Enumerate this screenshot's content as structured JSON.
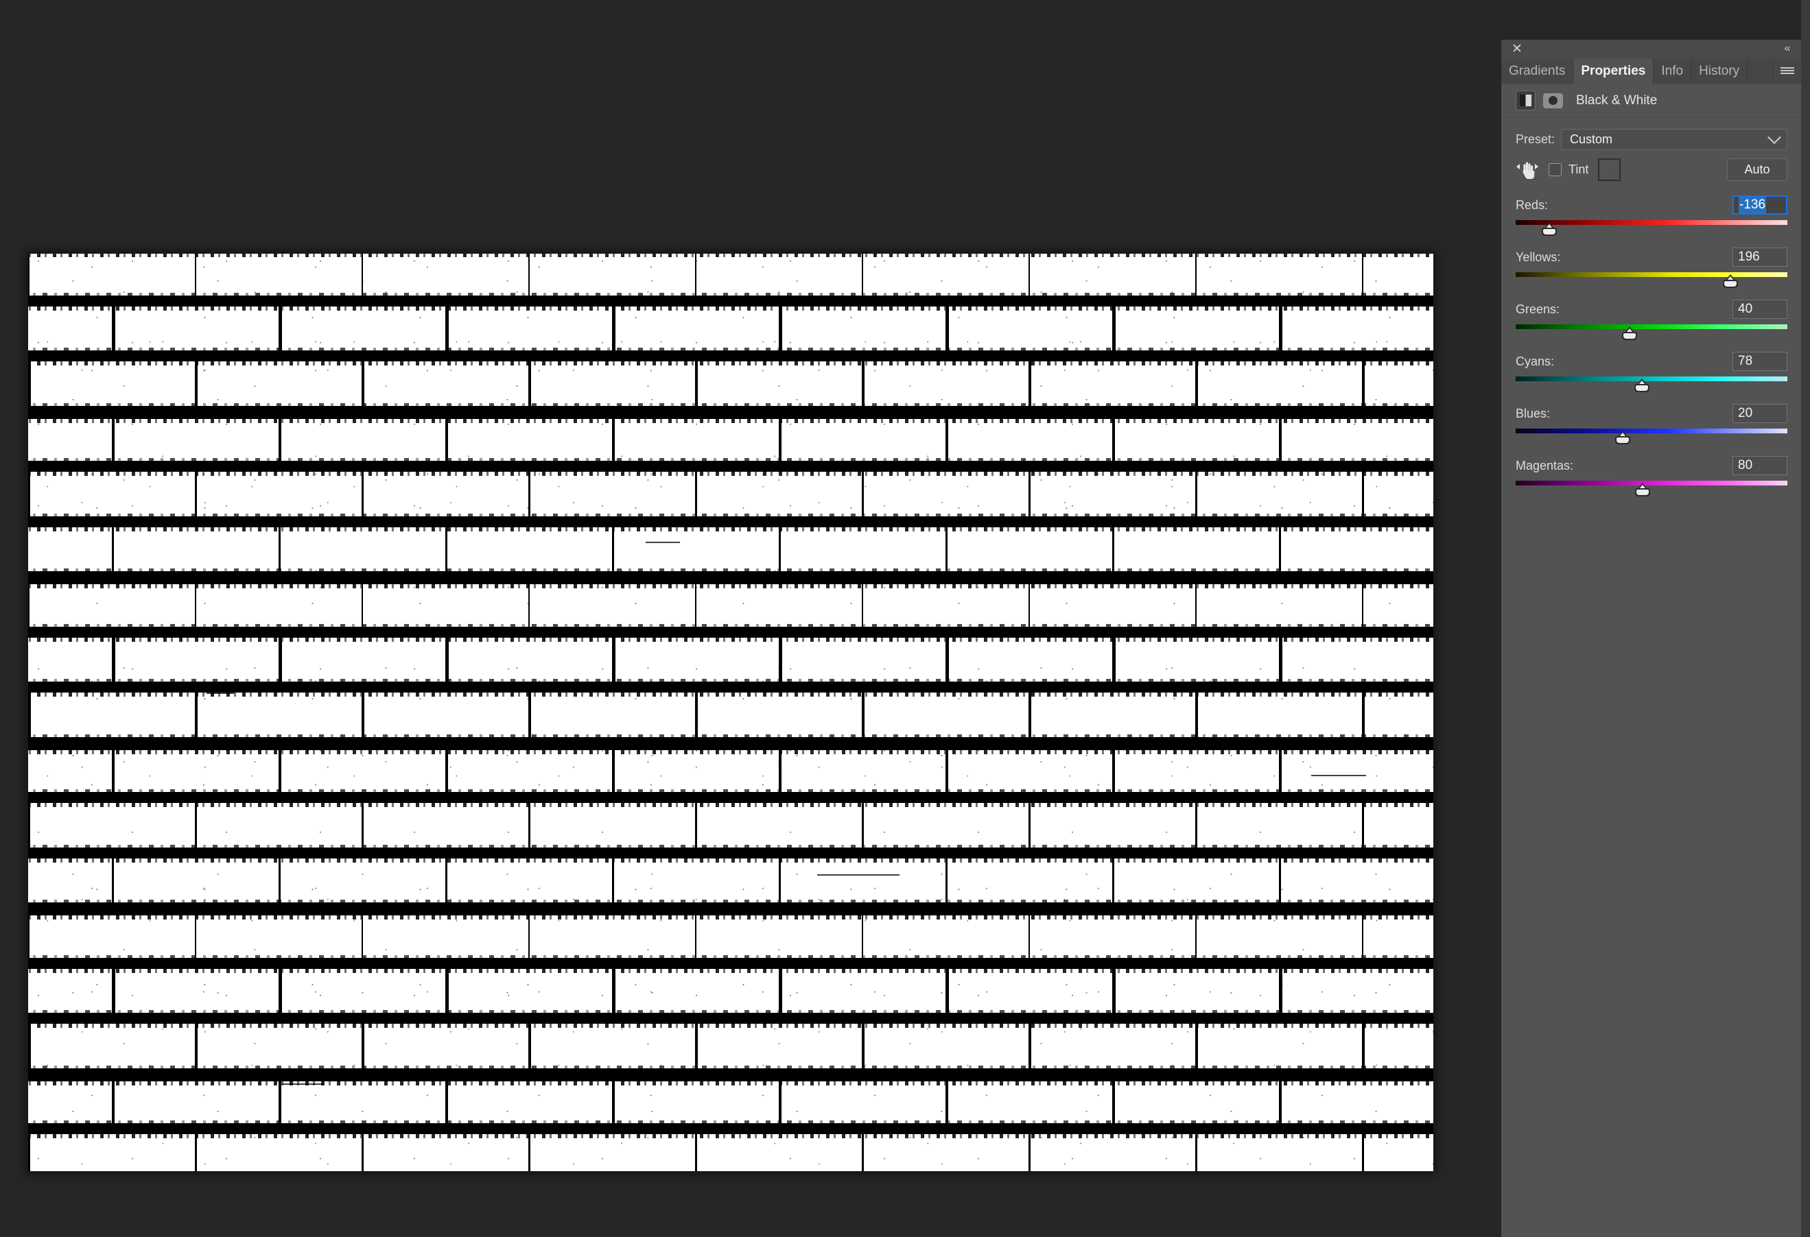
{
  "app": {
    "background_color": "#262626",
    "panel_color": "#535353"
  },
  "panel": {
    "close_icon": "✕",
    "collapse_icon": "«",
    "menu_icon": "panel-menu-icon",
    "tabs": [
      {
        "label": "Gradients",
        "active": false
      },
      {
        "label": "Properties",
        "active": true
      },
      {
        "label": "Info",
        "active": false
      },
      {
        "label": "History",
        "active": false
      }
    ],
    "adjustment": {
      "title": "Black & White",
      "layer_icon": "black-white-icon",
      "mask_icon": "layer-mask-icon"
    },
    "preset": {
      "label": "Preset:",
      "value": "Custom",
      "chevron": "chevron-down-icon"
    },
    "tint": {
      "hand_icon": "targeted-adjustment-hand-icon",
      "checkbox_checked": false,
      "label": "Tint",
      "swatch_color": "#535353"
    },
    "auto_button": {
      "label": "Auto"
    },
    "sliders": [
      {
        "name": "Reds:",
        "value": "-136",
        "pos_pct": 12.4,
        "track": "track-reds",
        "focused": true,
        "selected": true
      },
      {
        "name": "Yellows:",
        "value": "196",
        "pos_pct": 79.0,
        "track": "track-yellows",
        "focused": false,
        "selected": false
      },
      {
        "name": "Greens:",
        "value": "40",
        "pos_pct": 42.0,
        "track": "track-greens",
        "focused": false,
        "selected": false
      },
      {
        "name": "Cyans:",
        "value": "78",
        "pos_pct": 46.5,
        "track": "track-cyans",
        "focused": false,
        "selected": false
      },
      {
        "name": "Blues:",
        "value": "20",
        "pos_pct": 39.5,
        "track": "track-blues",
        "focused": false,
        "selected": false
      },
      {
        "name": "Magentas:",
        "value": "80",
        "pos_pct": 46.8,
        "track": "track-magentas",
        "focused": false,
        "selected": false
      }
    ]
  },
  "document": {
    "content": "black-and-white-brick-wall",
    "canvas_background": "#ffffff",
    "mortar_color": "#000000"
  }
}
